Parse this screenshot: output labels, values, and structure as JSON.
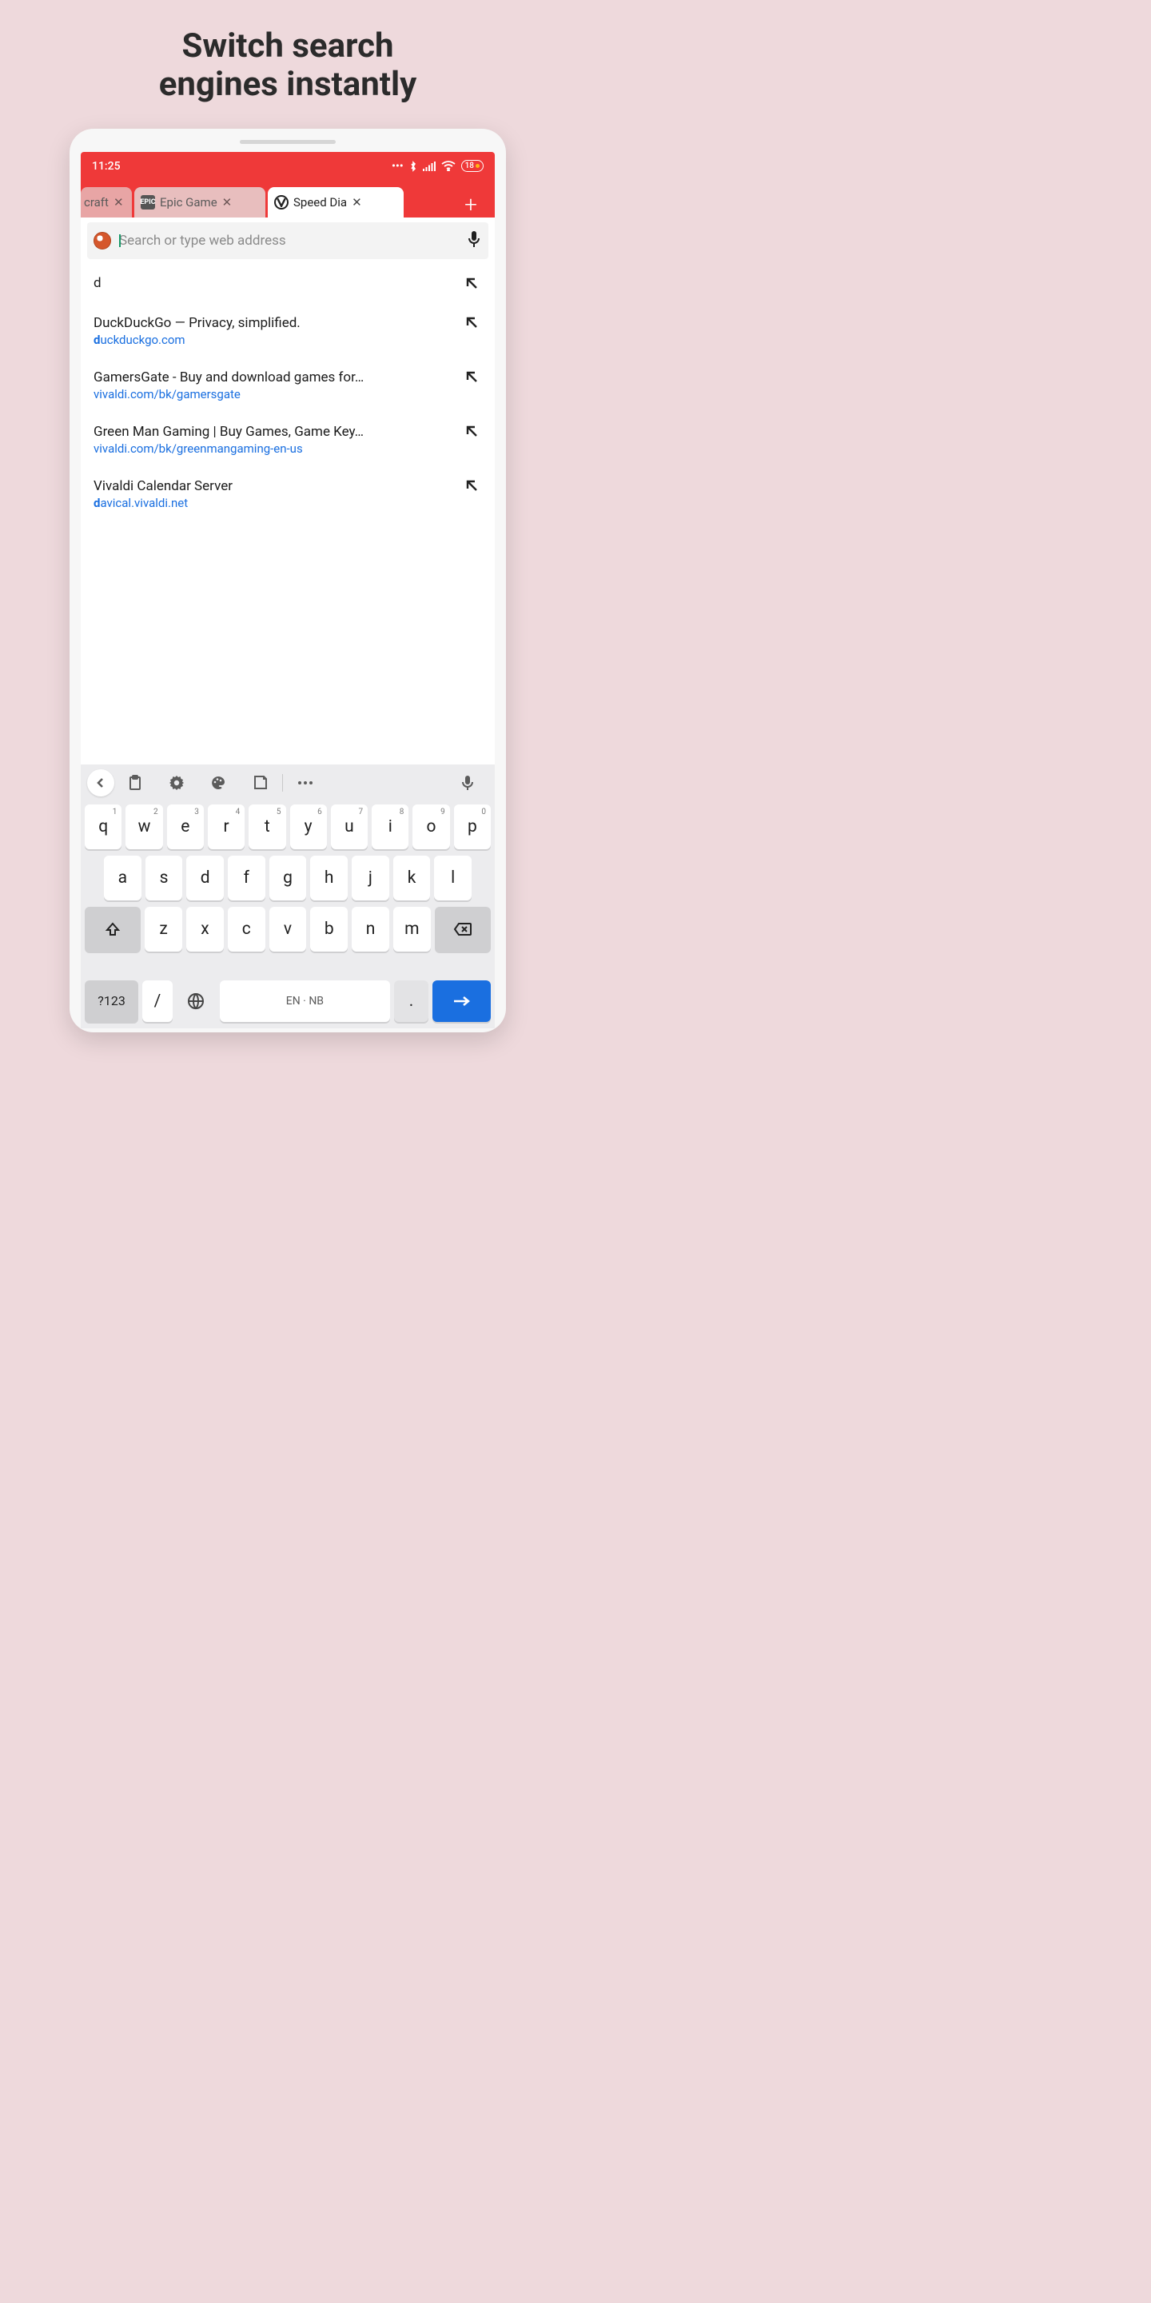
{
  "headline": {
    "line1": "Switch search",
    "line2": "engines instantly"
  },
  "statusbar": {
    "time": "11:25",
    "battery": "18"
  },
  "tabs": [
    {
      "label_fragment": "craft"
    },
    {
      "label": "Epic Game"
    },
    {
      "label": "Speed Dia"
    }
  ],
  "omnibox": {
    "placeholder": "Search or type web address"
  },
  "suggestions": [
    {
      "query": "d"
    },
    {
      "title": "DuckDuckGo — Privacy, simplified.",
      "url_pre": "d",
      "url_rest": "uckduckgo.com"
    },
    {
      "title": "GamersGate - Buy and download games for…",
      "url": "vivaldi.com/bk/gamersgate"
    },
    {
      "title": "Green Man Gaming | Buy Games, Game Key…",
      "url": "vivaldi.com/bk/greenmangaming-en-us"
    },
    {
      "title": "Vivaldi Calendar Server",
      "url_pre": "d",
      "url_rest": "avical.vivaldi.net"
    }
  ],
  "keyboard": {
    "row1": [
      {
        "k": "q",
        "n": "1"
      },
      {
        "k": "w",
        "n": "2"
      },
      {
        "k": "e",
        "n": "3"
      },
      {
        "k": "r",
        "n": "4"
      },
      {
        "k": "t",
        "n": "5"
      },
      {
        "k": "y",
        "n": "6"
      },
      {
        "k": "u",
        "n": "7"
      },
      {
        "k": "i",
        "n": "8"
      },
      {
        "k": "o",
        "n": "9"
      },
      {
        "k": "p",
        "n": "0"
      }
    ],
    "row2": [
      "a",
      "s",
      "d",
      "f",
      "g",
      "h",
      "j",
      "k",
      "l"
    ],
    "row3": [
      "z",
      "x",
      "c",
      "v",
      "b",
      "n",
      "m"
    ],
    "symbols": "?123",
    "slash": "/",
    "space": "EN · NB",
    "period": "."
  }
}
